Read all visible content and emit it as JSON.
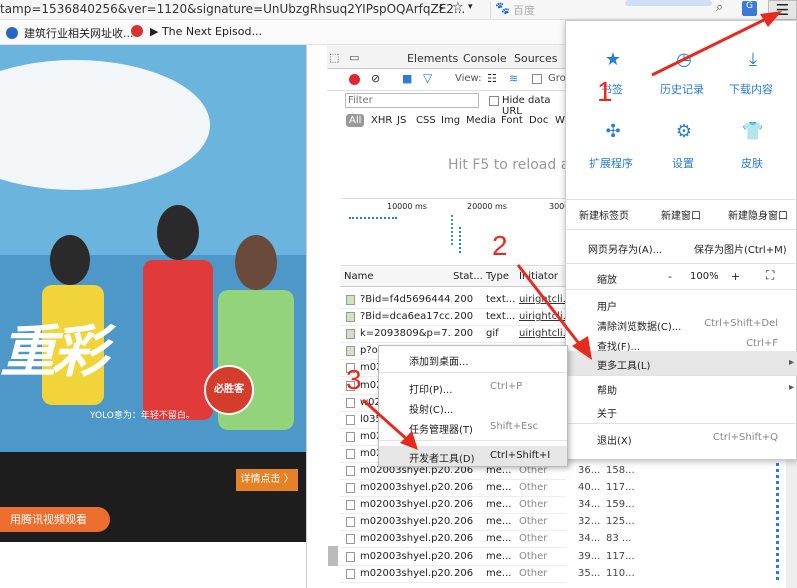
{
  "address_bar": {
    "url": "tamp=1536840256&ver=1120&signature=UnUbzgRhsuq2YIPspOQArfqZE2...",
    "search_placeholder": "百度"
  },
  "bookmarks": [
    {
      "label": "建筑行业相关网址收...",
      "color": "#2a67c5"
    },
    {
      "label": "",
      "color": "#d8342f"
    },
    {
      "label": "▶ The Next Episod...",
      "color": ""
    }
  ],
  "webpage": {
    "big_text": "重彩",
    "yolo_caption": "YOLO意为：年轻不留白。",
    "badge": "必胜客",
    "detail_button": "详情点击 〉",
    "watch_button": "用腾讯视频观看"
  },
  "devtools": {
    "tabs": [
      "Elements",
      "Console",
      "Sources"
    ],
    "view_label": "View:",
    "group_label": "Gro",
    "filter_placeholder": "Filter",
    "hide_data_url": "Hide data URL",
    "type_filters": [
      "All",
      "XHR",
      "JS",
      "CSS",
      "Img",
      "Media",
      "Font",
      "Doc",
      "WS"
    ],
    "hint": "Hit F5 to reload ar",
    "timeline_ticks": [
      "10000 ms",
      "20000 ms",
      "3000"
    ],
    "columns": [
      "Name",
      "Stat...",
      "Type",
      "Initiator"
    ],
    "rows": [
      {
        "name": "?Bid=f4d5696444...",
        "status": "200",
        "type": "text...",
        "initiator": "uirightcli..."
      },
      {
        "name": "?Bid=dca6ea17cc...",
        "status": "200",
        "type": "text...",
        "initiator": "uirightcli..."
      },
      {
        "name": "k=2093809&p=7...",
        "status": "200",
        "type": "gif",
        "initiator": "uirightcli..."
      },
      {
        "name": "p?ol",
        "status": "",
        "type": "",
        "initiator": ""
      },
      {
        "name": "m02",
        "status": "",
        "type": "",
        "initiator": ""
      },
      {
        "name": "m02",
        "status": "",
        "type": "",
        "initiator": ""
      },
      {
        "name": "w02",
        "status": "",
        "type": "",
        "initiator": ""
      },
      {
        "name": "l035",
        "status": "",
        "type": "",
        "initiator": ""
      },
      {
        "name": "m02",
        "status": "",
        "type": "",
        "initiator": ""
      },
      {
        "name": "m02",
        "status": "",
        "type": "",
        "initiator": "",
        "size": "34...",
        "time": "88 ..."
      },
      {
        "name": "m02003shyel.p20...",
        "status": "206",
        "type": "me...",
        "initiator": "Other",
        "size": "36...",
        "time": "158..."
      },
      {
        "name": "m02003shyel.p20...",
        "status": "206",
        "type": "me...",
        "initiator": "Other",
        "size": "40...",
        "time": "117..."
      },
      {
        "name": "m02003shyel.p20...",
        "status": "206",
        "type": "me...",
        "initiator": "Other",
        "size": "34...",
        "time": "159..."
      },
      {
        "name": "m02003shyel.p20...",
        "status": "206",
        "type": "me...",
        "initiator": "Other",
        "size": "32...",
        "time": "125..."
      },
      {
        "name": "m02003shyel.p20...",
        "status": "206",
        "type": "me...",
        "initiator": "Other",
        "size": "34...",
        "time": "83 ..."
      },
      {
        "name": "m02003shyel.p20...",
        "status": "206",
        "type": "me...",
        "initiator": "Other",
        "size": "39...",
        "time": "117..."
      },
      {
        "name": "m02003shyel.p20...",
        "status": "206",
        "type": "me...",
        "initiator": "Other",
        "size": "35...",
        "time": "110..."
      }
    ]
  },
  "main_menu": {
    "grid": [
      {
        "label": "书签",
        "icon": "bookmark-icon",
        "glyph": "★"
      },
      {
        "label": "历史记录",
        "icon": "history-icon",
        "glyph": "◷"
      },
      {
        "label": "下载内容",
        "icon": "download-icon",
        "glyph": "⤓"
      },
      {
        "label": "扩展程序",
        "icon": "extension-icon",
        "glyph": "✣"
      },
      {
        "label": "设置",
        "icon": "settings-icon",
        "glyph": "⚙"
      },
      {
        "label": "皮肤",
        "icon": "skin-icon",
        "glyph": "👕"
      }
    ],
    "window_row": [
      "新建标签页",
      "新建窗口",
      "新建隐身窗口"
    ],
    "save_row": [
      "网页另存为(A)...",
      "保存为图片(Ctrl+M)"
    ],
    "zoom": {
      "label": "缩放",
      "minus": "-",
      "value": "100%",
      "plus": "+"
    },
    "items": [
      {
        "label": "用户",
        "shortcut": ""
      },
      {
        "label": "清除浏览数据(C)...",
        "shortcut": "Ctrl+Shift+Del"
      },
      {
        "label": "查找(F)...",
        "shortcut": "Ctrl+F"
      },
      {
        "label": "更多工具(L)",
        "shortcut": "▸"
      },
      {
        "label": "帮助",
        "shortcut": "▸"
      },
      {
        "label": "关于",
        "shortcut": ""
      },
      {
        "label": "退出(X)",
        "shortcut": "Ctrl+Shift+Q"
      }
    ]
  },
  "context_menu": {
    "items": [
      {
        "label": "添加到桌面...",
        "shortcut": ""
      },
      {
        "label": "打印(P)...",
        "shortcut": "Ctrl+P"
      },
      {
        "label": "投射(C)...",
        "shortcut": ""
      },
      {
        "label": "任务管理器(T)",
        "shortcut": "Shift+Esc"
      },
      {
        "label": "开发者工具(D)",
        "shortcut": "Ctrl+Shift+I"
      }
    ]
  },
  "annotations": [
    "1",
    "2",
    "3"
  ],
  "colors": {
    "accent": "#2c7cd6",
    "arrow": "#e52b1f",
    "record": "#e0272c",
    "orange": "#ec6e2f"
  }
}
